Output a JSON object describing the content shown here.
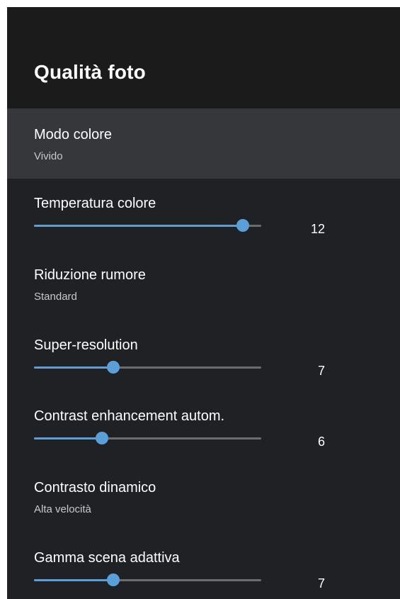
{
  "header": {
    "title": "Qualità foto"
  },
  "accent_color": "#5a9fd8",
  "settings": [
    {
      "label": "Modo colore",
      "value": "Vivido"
    },
    {
      "label": "Temperatura colore",
      "value": "12",
      "level": 0.92
    },
    {
      "label": "Riduzione rumore",
      "value": "Standard"
    },
    {
      "label": "Super-resolution",
      "value": "7",
      "level": 0.35
    },
    {
      "label": "Contrast enhancement autom.",
      "value": "6",
      "level": 0.3
    },
    {
      "label": "Contrasto dinamico",
      "value": "Alta velocità"
    },
    {
      "label": "Gamma scena adattiva",
      "value": "7",
      "level": 0.35
    }
  ]
}
